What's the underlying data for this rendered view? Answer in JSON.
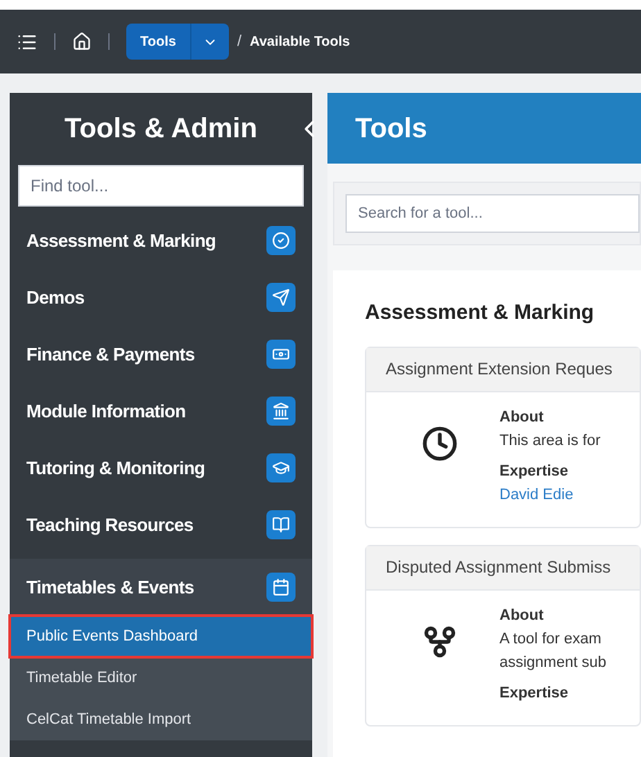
{
  "breadcrumb": {
    "button": "Tools",
    "separator": "/",
    "current": "Available Tools"
  },
  "sidebar": {
    "title": "Tools & Admin",
    "search": {
      "placeholder": "Find tool..."
    },
    "items": [
      {
        "label": "Assessment & Marking",
        "expanded": false
      },
      {
        "label": "Demos",
        "expanded": false
      },
      {
        "label": "Finance & Payments",
        "expanded": false
      },
      {
        "label": "Module Information",
        "expanded": false
      },
      {
        "label": "Tutoring & Monitoring",
        "expanded": false
      },
      {
        "label": "Teaching Resources",
        "expanded": false
      },
      {
        "label": "Timetables & Events",
        "expanded": true,
        "children": [
          {
            "label": "Public Events Dashboard",
            "selected": true
          },
          {
            "label": "Timetable Editor",
            "selected": false
          },
          {
            "label": "CelCat Timetable Import",
            "selected": false
          }
        ]
      }
    ]
  },
  "main": {
    "title": "Tools",
    "search": {
      "placeholder": "Search for a tool..."
    },
    "section": "Assessment & Marking",
    "cards": [
      {
        "title": "Assignment Extension Reques",
        "about_label": "About",
        "about": [
          "This area is for"
        ],
        "expertise_label": "Expertise",
        "expertise": "David Edie"
      },
      {
        "title": "Disputed Assignment Submiss",
        "about_label": "About",
        "about": [
          "A tool for exam",
          "assignment sub"
        ],
        "expertise_label": "Expertise"
      }
    ]
  }
}
